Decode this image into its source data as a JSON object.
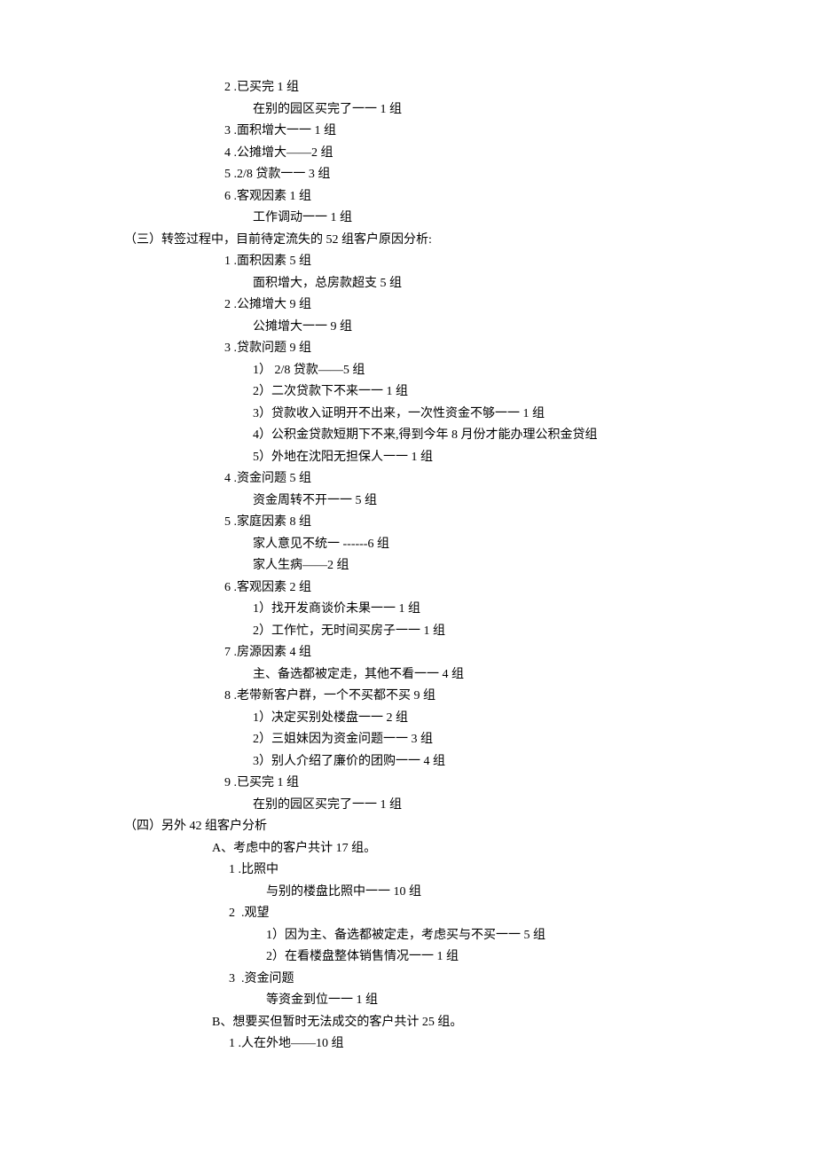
{
  "lines": [
    {
      "cls": "c-n",
      "t": "2 .已买完 1 组"
    },
    {
      "cls": "c-sub",
      "t": "在别的园区买完了一一 1 组"
    },
    {
      "cls": "c-n",
      "t": "3 .面积增大一一 1 组"
    },
    {
      "cls": "c-n",
      "t": "4 .公摊增大——2 组"
    },
    {
      "cls": "c-n",
      "t": "5 .2/8 贷款一一 3 组"
    },
    {
      "cls": "c-n",
      "t": "6 .客观因素 1 组"
    },
    {
      "cls": "c-sub",
      "t": "工作调动一一 1 组"
    },
    {
      "cls": "c-h3",
      "t": "（三）转签过程中，目前待定流失的 52 组客户原因分析:"
    },
    {
      "cls": "c-n",
      "t": "1 .面积因素 5 组"
    },
    {
      "cls": "c-sub",
      "t": "面积增大，总房款超支 5 组"
    },
    {
      "cls": "c-n",
      "t": "2 .公摊增大 9 组"
    },
    {
      "cls": "c-sub",
      "t": "公摊增大一一 9 组"
    },
    {
      "cls": "c-n",
      "t": "3 .贷款问题 9 组"
    },
    {
      "cls": "c-sub",
      "t": "1） 2/8 贷款——5 组"
    },
    {
      "cls": "c-sub",
      "t": "2）二次贷款下不来一一 1 组"
    },
    {
      "cls": "c-sub",
      "t": "3）贷款收入证明开不出来，一次性资金不够一一 1 组"
    },
    {
      "cls": "c-sub",
      "t": "4）公积金贷款短期下不来,得到今年 8 月份才能办理公积金贷组"
    },
    {
      "cls": "c-sub",
      "t": "5）外地在沈阳无担保人一一 1 组"
    },
    {
      "cls": "c-n",
      "t": "4 .资金问题 5 组"
    },
    {
      "cls": "c-sub",
      "t": "资金周转不开一一 5 组"
    },
    {
      "cls": "c-n",
      "t": "5 .家庭因素 8 组"
    },
    {
      "cls": "c-sub",
      "t": "家人意见不统一 ------6 组"
    },
    {
      "cls": "c-sub",
      "t": "家人生病——2 组"
    },
    {
      "cls": "c-n",
      "t": "6 .客观因素 2 组"
    },
    {
      "cls": "c-sub",
      "t": "1）找开发商谈价未果一一 1 组"
    },
    {
      "cls": "c-sub",
      "t": "2）工作忙，无时间买房子一一 1 组"
    },
    {
      "cls": "c-n",
      "t": "7 .房源因素 4 组"
    },
    {
      "cls": "c-sub",
      "t": "主、备选都被定走，其他不看一一 4 组"
    },
    {
      "cls": "c-n",
      "t": "8 .老带新客户群，一个不买都不买 9 组"
    },
    {
      "cls": "c-sub",
      "t": "1）决定买别处楼盘一一 2 组"
    },
    {
      "cls": "c-sub",
      "t": "2）三姐妹因为资金问题一一 3 组"
    },
    {
      "cls": "c-sub",
      "t": "3）别人介绍了廉价的团购一一 4 组"
    },
    {
      "cls": "c-n",
      "t": "9 .已买完 1 组"
    },
    {
      "cls": "c-sub",
      "t": "在别的园区买完了一一 1 组"
    },
    {
      "cls": "c-h3",
      "t": "（四）另外 42 组客户分析"
    },
    {
      "cls": "c-abc",
      "t": "A、考虑中的客户共计 17 组。"
    },
    {
      "cls": "c-n2",
      "t": "1 .比照中"
    },
    {
      "cls": "c-sub2",
      "t": "与别的楼盘比照中一一 10 组"
    },
    {
      "cls": "c-n2",
      "t": "2  .观望"
    },
    {
      "cls": "c-sub2",
      "t": "1）因为主、备选都被定走，考虑买与不买一一 5 组"
    },
    {
      "cls": "c-sub2",
      "t": "2）在看楼盘整体销售情况一一 1 组"
    },
    {
      "cls": "c-n2",
      "t": "3  .资金问题"
    },
    {
      "cls": "c-sub2",
      "t": "等资金到位一一 1 组"
    },
    {
      "cls": "c-abc",
      "t": "B、想要买但暂时无法成交的客户共计 25 组。"
    },
    {
      "cls": "c-n2",
      "t": "1 .人在外地——10 组"
    }
  ]
}
